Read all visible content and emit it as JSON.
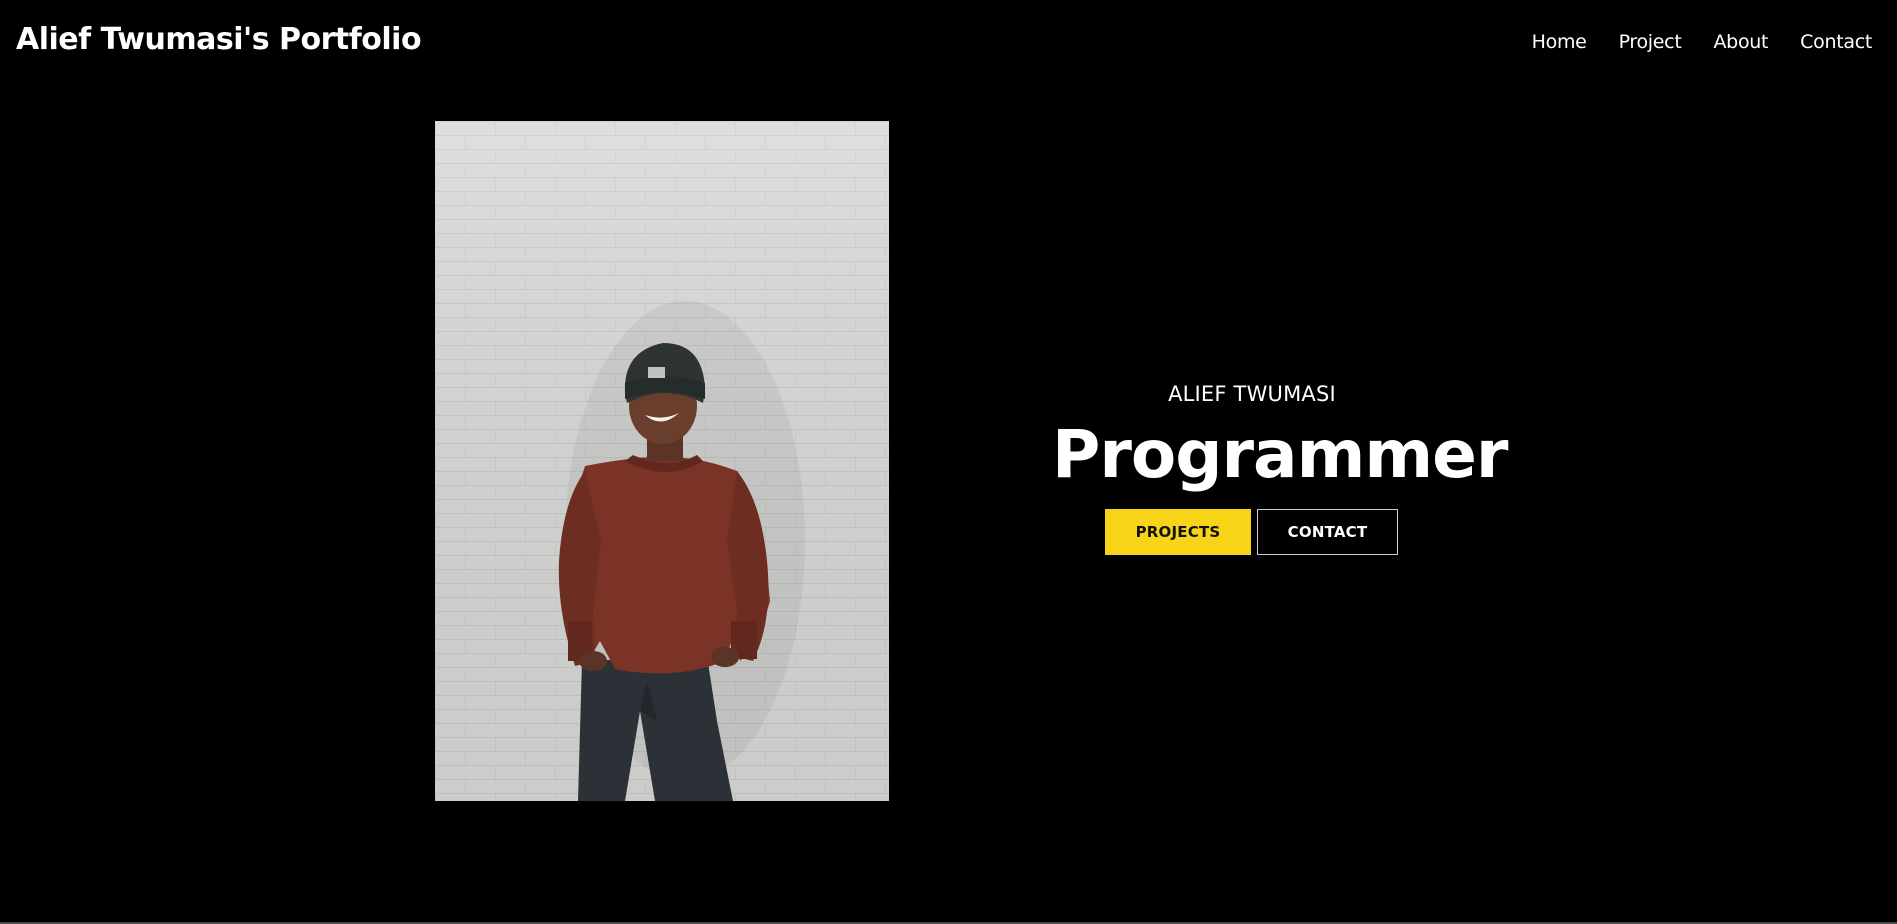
{
  "header": {
    "site_title": "Alief Twumasi's Portfolio",
    "nav": [
      {
        "label": "Home"
      },
      {
        "label": "Project"
      },
      {
        "label": "About"
      },
      {
        "label": "Contact"
      }
    ]
  },
  "hero": {
    "name": "ALIEF TWUMASI",
    "role": "Programmer",
    "buttons": {
      "projects_label": "PROJECTS",
      "contact_label": "CONTACT"
    }
  },
  "colors": {
    "background": "#000000",
    "text": "#ffffff",
    "accent_yellow": "#f7d417"
  },
  "photo": {
    "description_icon": "portrait-photo"
  }
}
